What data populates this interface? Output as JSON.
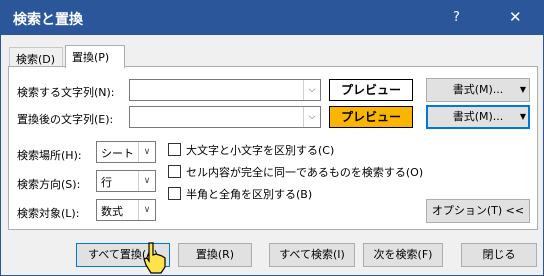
{
  "window": {
    "title": "検索と置換",
    "help": "?",
    "close": "✕"
  },
  "tabs": [
    {
      "label": "検索(D)"
    },
    {
      "label": "置換(P)"
    }
  ],
  "find": {
    "label": "検索する文字列(N):",
    "value": "",
    "preview": "プレビュー",
    "format_button": "書式(M)...",
    "preview_bg": "#ffffff"
  },
  "replace": {
    "label": "置換後の文字列(E):",
    "value": "",
    "preview": "プレビュー",
    "format_button": "書式(M)...",
    "preview_bg": "#f9b500"
  },
  "options": {
    "scope_label": "検索場所(H):",
    "scope_value": "シート",
    "direction_label": "検索方向(S):",
    "direction_value": "行",
    "target_label": "検索対象(L):",
    "target_value": "数式",
    "match_case": "大文字と小文字を区別する(C)",
    "match_entire": "セル内容が完全に同一であるものを検索する(O)",
    "match_byte": "半角と全角を区別する(B)",
    "options_button": "オプション(T) <<"
  },
  "buttons": {
    "replace_all": "すべて置換(A)",
    "replace": "置換(R)",
    "find_all": "すべて検索(I)",
    "find_next": "次を検索(F)",
    "close": "閉じる"
  },
  "colors": {
    "titlebar": "#2b579a",
    "accent": "#0078d7"
  }
}
